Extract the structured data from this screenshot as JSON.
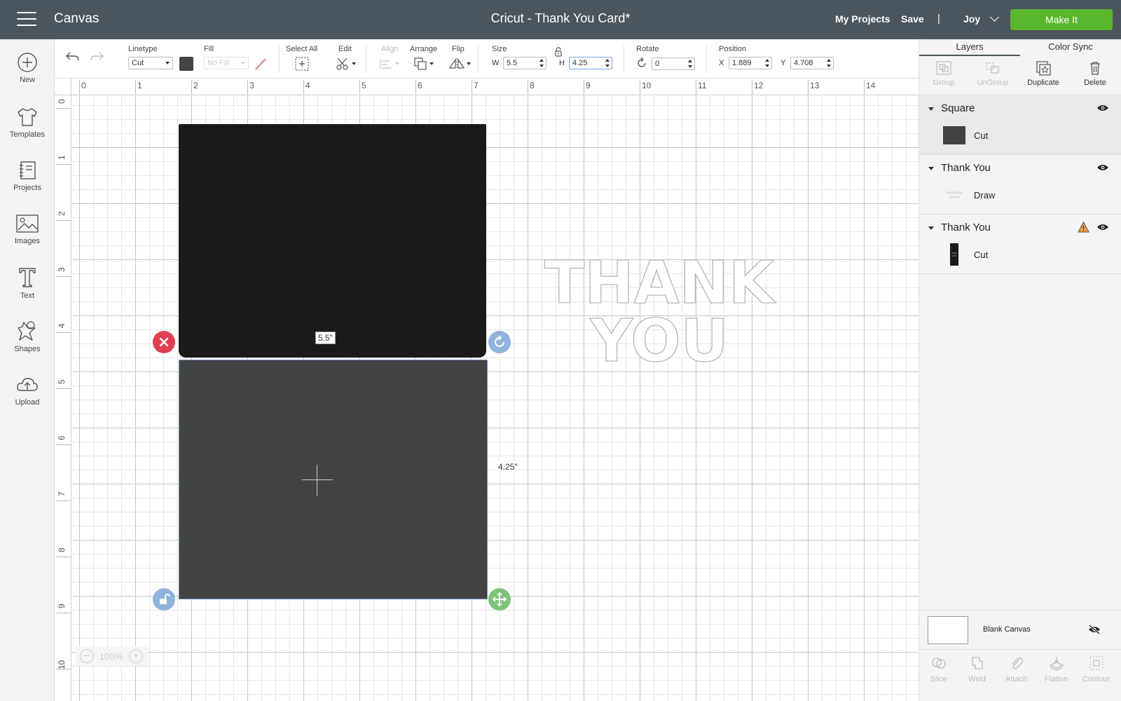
{
  "header": {
    "app_title": "Canvas",
    "doc_title": "Cricut - Thank You Card*",
    "my_projects": "My Projects",
    "save": "Save",
    "separator": "|",
    "user_name": "Joy",
    "make_it": "Make It",
    "colors": {
      "bar": "#4b555d",
      "make_it": "#5ab72d"
    }
  },
  "sidebar": {
    "items": [
      {
        "label": "New",
        "icon": "plus-circle-icon"
      },
      {
        "label": "Templates",
        "icon": "tshirt-icon"
      },
      {
        "label": "Projects",
        "icon": "notebook-icon"
      },
      {
        "label": "Images",
        "icon": "image-icon"
      },
      {
        "label": "Text",
        "icon": "text-t-icon"
      },
      {
        "label": "Shapes",
        "icon": "shapes-icon"
      },
      {
        "label": "Upload",
        "icon": "cloud-upload-icon"
      }
    ]
  },
  "toolbar": {
    "linetype_label": "Linetype",
    "linetype_value": "Cut",
    "linetype_color": "#434343",
    "fill_label": "Fill",
    "fill_value": "No Fill",
    "select_all_label": "Select All",
    "edit_label": "Edit",
    "align_label": "Align",
    "arrange_label": "Arrange",
    "flip_label": "Flip",
    "size_label": "Size",
    "w_letter": "W",
    "w_value": "5.5",
    "h_letter": "H",
    "h_value": "4.25",
    "rotate_label": "Rotate",
    "rotate_value": "0",
    "position_label": "Position",
    "x_letter": "X",
    "x_value": "1.889",
    "y_letter": "Y",
    "y_value": "4.708"
  },
  "rulers": {
    "top": [
      "0",
      "1",
      "2",
      "3",
      "4",
      "5",
      "6",
      "7",
      "8",
      "9",
      "10",
      "11",
      "12",
      "13",
      "14"
    ],
    "left": [
      "0",
      "1",
      "2",
      "3",
      "4",
      "5",
      "6",
      "7",
      "8",
      "9",
      "10"
    ]
  },
  "canvas": {
    "width_label": "5.5\"",
    "height_label": "4.25\"",
    "thank_you_line1": "THANK",
    "thank_you_line2": "YOU",
    "zoom_minus": "−",
    "zoom_value": "100%",
    "zoom_plus": "+",
    "colors": {
      "black_shape": "#1a1a1a",
      "gray_shape": "#434343",
      "delete_handle": "#e0404f",
      "rotate_handle": "#8fb3dc",
      "lock_handle": "#8fb3dc",
      "resize_handle": "#7cc47a"
    }
  },
  "right_panel": {
    "tabs": [
      "Layers",
      "Color Sync"
    ],
    "layer_tools": [
      {
        "label": "Group",
        "enabled": false
      },
      {
        "label": "UnGroup",
        "enabled": false
      },
      {
        "label": "Duplicate",
        "enabled": true
      },
      {
        "label": "Delete",
        "enabled": true
      }
    ],
    "layers": [
      {
        "name": "Square",
        "operation": "Cut",
        "warning": false
      },
      {
        "name": "Thank You",
        "operation": "Draw",
        "warning": false
      },
      {
        "name": "Thank You",
        "operation": "Cut",
        "warning": true
      }
    ],
    "blank_canvas_label": "Blank Canvas",
    "bottom_tools": [
      "Slice",
      "Weld",
      "Attach",
      "Flatten",
      "Contour"
    ]
  }
}
